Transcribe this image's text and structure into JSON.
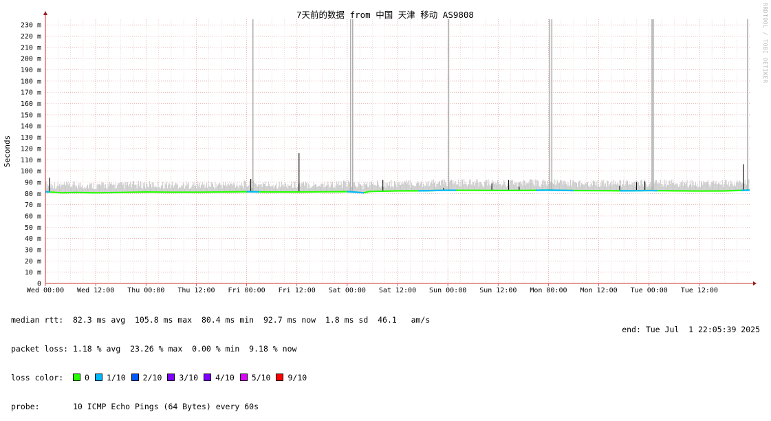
{
  "chart_data": {
    "type": "line",
    "title": "7天前的数据 from 中国 天津 移动 AS9808",
    "ylabel": "Seconds",
    "ylim": [
      0,
      235
    ],
    "y_ticks": [
      {
        "value": 0,
        "label": "0"
      },
      {
        "value": 10,
        "label": "10 m"
      },
      {
        "value": 20,
        "label": "20 m"
      },
      {
        "value": 30,
        "label": "30 m"
      },
      {
        "value": 40,
        "label": "40 m"
      },
      {
        "value": 50,
        "label": "50 m"
      },
      {
        "value": 60,
        "label": "60 m"
      },
      {
        "value": 70,
        "label": "70 m"
      },
      {
        "value": 80,
        "label": "80 m"
      },
      {
        "value": 90,
        "label": "90 m"
      },
      {
        "value": 100,
        "label": "100 m"
      },
      {
        "value": 110,
        "label": "110 m"
      },
      {
        "value": 120,
        "label": "120 m"
      },
      {
        "value": 130,
        "label": "130 m"
      },
      {
        "value": 140,
        "label": "140 m"
      },
      {
        "value": 150,
        "label": "150 m"
      },
      {
        "value": 160,
        "label": "160 m"
      },
      {
        "value": 170,
        "label": "170 m"
      },
      {
        "value": 180,
        "label": "180 m"
      },
      {
        "value": 190,
        "label": "190 m"
      },
      {
        "value": 200,
        "label": "200 m"
      },
      {
        "value": 210,
        "label": "210 m"
      },
      {
        "value": 220,
        "label": "220 m"
      },
      {
        "value": 230,
        "label": "230 m"
      }
    ],
    "xlim": [
      0,
      168
    ],
    "x_ticks": [
      {
        "value": 0,
        "label": "Wed 00:00"
      },
      {
        "value": 12,
        "label": "Wed 12:00"
      },
      {
        "value": 24,
        "label": "Thu 00:00"
      },
      {
        "value": 36,
        "label": "Thu 12:00"
      },
      {
        "value": 48,
        "label": "Fri 00:00"
      },
      {
        "value": 60,
        "label": "Fri 12:00"
      },
      {
        "value": 72,
        "label": "Sat 00:00"
      },
      {
        "value": 84,
        "label": "Sat 12:00"
      },
      {
        "value": 96,
        "label": "Sun 00:00"
      },
      {
        "value": 108,
        "label": "Sun 12:00"
      },
      {
        "value": 120,
        "label": "Mon 00:00"
      },
      {
        "value": 132,
        "label": "Mon 12:00"
      },
      {
        "value": 144,
        "label": "Tue 00:00"
      },
      {
        "value": 156,
        "label": "Tue 12:00"
      }
    ],
    "grid": true,
    "series": [
      {
        "name": "median rtt",
        "x": [
          0,
          4,
          7,
          12,
          18,
          24,
          30,
          36,
          42,
          48,
          54,
          60,
          66,
          72,
          76,
          77,
          78,
          84,
          90,
          96,
          102,
          108,
          114,
          120,
          126,
          132,
          138,
          144,
          150,
          156,
          162,
          168
        ],
        "values": [
          81.5,
          80.6,
          80.9,
          80.6,
          80.9,
          81.3,
          81.1,
          81.1,
          81.3,
          81.6,
          81.3,
          81.3,
          81.5,
          81.7,
          80.6,
          81.6,
          81.9,
          82.3,
          82.4,
          82.9,
          82.8,
          82.7,
          82.7,
          83.0,
          82.6,
          82.5,
          82.4,
          82.6,
          82.4,
          82.2,
          82.3,
          83.0
        ]
      }
    ],
    "loss_segments": [
      {
        "from": 0,
        "to": 1,
        "loss": "1/10"
      },
      {
        "from": 48,
        "to": 51,
        "loss": "1/10"
      },
      {
        "from": 72,
        "to": 76,
        "loss": "1/10"
      },
      {
        "from": 89,
        "to": 98,
        "loss": "1/10"
      },
      {
        "from": 117,
        "to": 126,
        "loss": "1/10"
      },
      {
        "from": 137,
        "to": 146,
        "loss": "1/10"
      },
      {
        "from": 166,
        "to": 168,
        "loss": "1/10"
      }
    ],
    "spikes": [
      {
        "x": 49.5,
        "value": 235
      },
      {
        "x": 72.8,
        "value": 235
      },
      {
        "x": 73.3,
        "value": 235
      },
      {
        "x": 96.2,
        "value": 235
      },
      {
        "x": 120.3,
        "value": 235
      },
      {
        "x": 120.8,
        "value": 235
      },
      {
        "x": 144.7,
        "value": 235
      },
      {
        "x": 145.0,
        "value": 235
      },
      {
        "x": 167.5,
        "value": 235
      }
    ],
    "dark_peaks": [
      {
        "x": 1,
        "value": 94
      },
      {
        "x": 49,
        "value": 93
      },
      {
        "x": 60.5,
        "value": 116
      },
      {
        "x": 80.5,
        "value": 92
      },
      {
        "x": 95,
        "value": 85
      },
      {
        "x": 106.5,
        "value": 89
      },
      {
        "x": 110.5,
        "value": 92
      },
      {
        "x": 113,
        "value": 86
      },
      {
        "x": 137,
        "value": 87
      },
      {
        "x": 141,
        "value": 90
      },
      {
        "x": 143,
        "value": 91
      },
      {
        "x": 166.5,
        "value": 106
      }
    ],
    "loss_colors": {
      "0": "#26ff00",
      "1/10": "#00b8ff",
      "2/10": "#0059ff",
      "3/10": "#7e00ff",
      "4/10": "#7e00ff",
      "5/10": "#dd00ff",
      "9/10": "#ff0000"
    },
    "watermark": "RRDTOOL / TOBI OETIKER"
  },
  "legend": {
    "median_rtt": "median rtt:  82.3 ms avg  105.8 ms max  80.4 ms min  92.7 ms now  1.8 ms sd  46.1   am/s",
    "packet_loss": "packet loss: 1.18 % avg  23.26 % max  0.00 % min  9.18 % now",
    "loss_color_label": "loss color:",
    "loss_color_items": [
      {
        "label": "0",
        "color": "#26ff00"
      },
      {
        "label": "1/10",
        "color": "#00b8ff"
      },
      {
        "label": "2/10",
        "color": "#0059ff"
      },
      {
        "label": "3/10",
        "color": "#7e00ff"
      },
      {
        "label": "4/10",
        "color": "#7e00ff"
      },
      {
        "label": "5/10",
        "color": "#dd00ff"
      },
      {
        "label": "9/10",
        "color": "#ff0000"
      }
    ],
    "probe": "probe:       10 ICMP Echo Pings (64 Bytes) every 60s",
    "end": "end: Tue Jul  1 22:05:39 2025"
  }
}
